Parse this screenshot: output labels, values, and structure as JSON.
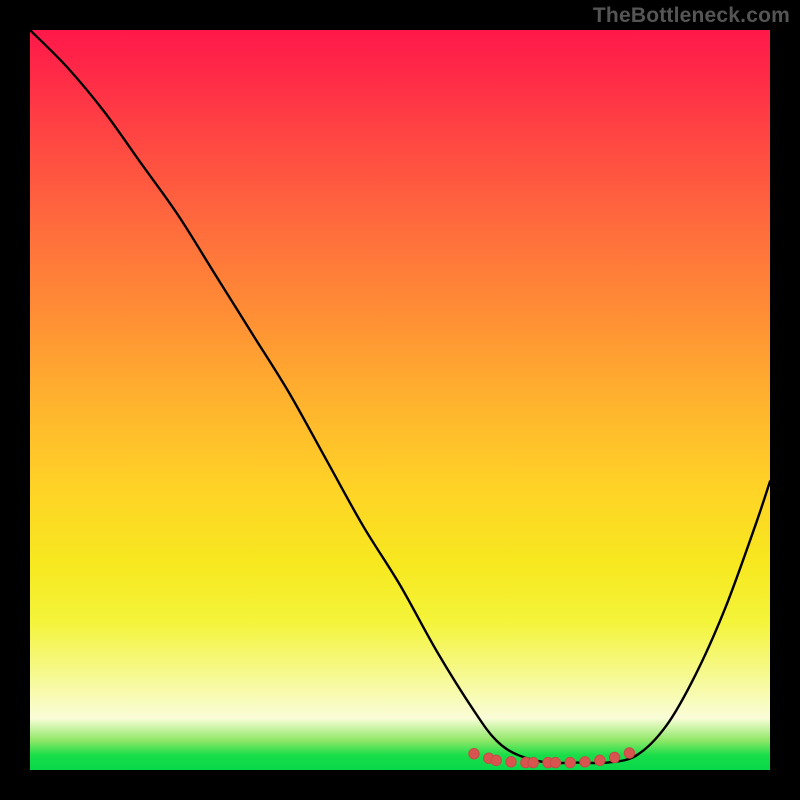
{
  "watermark": "TheBottleneck.com",
  "colors": {
    "frame": "#000000",
    "watermark": "#555555",
    "curve": "#000000",
    "dot_fill": "#d8544f",
    "dot_stroke": "#c74b46"
  },
  "chart_data": {
    "type": "line",
    "title": "",
    "xlabel": "",
    "ylabel": "",
    "xlim": [
      0,
      100
    ],
    "ylim": [
      0,
      100
    ],
    "grid": false,
    "legend": false,
    "background": "rainbow_vertical_gradient",
    "note": "No numeric axes or tick labels are shown; values are estimated from geometry. y represents curve height as percent of plot height (0 = bottom/green, 100 = top/red).",
    "series": [
      {
        "name": "bottleneck-curve",
        "x": [
          0,
          5,
          10,
          15,
          20,
          25,
          30,
          35,
          40,
          45,
          50,
          55,
          60,
          63,
          66,
          70,
          74,
          78,
          82,
          86,
          90,
          94,
          98,
          100
        ],
        "y": [
          100,
          95,
          89,
          82,
          75,
          67,
          59,
          51,
          42,
          33,
          25,
          16,
          8,
          4,
          2,
          1,
          1,
          1,
          2,
          6,
          13,
          22,
          33,
          39
        ]
      }
    ],
    "minimum_marker": {
      "name": "highlight-dots",
      "x": [
        60,
        62,
        63,
        65,
        67,
        68,
        70,
        71,
        73,
        75,
        77,
        79,
        81
      ],
      "y": [
        2.2,
        1.6,
        1.3,
        1.1,
        1.0,
        1.0,
        1.0,
        1.0,
        1.0,
        1.1,
        1.3,
        1.7,
        2.3
      ]
    }
  }
}
